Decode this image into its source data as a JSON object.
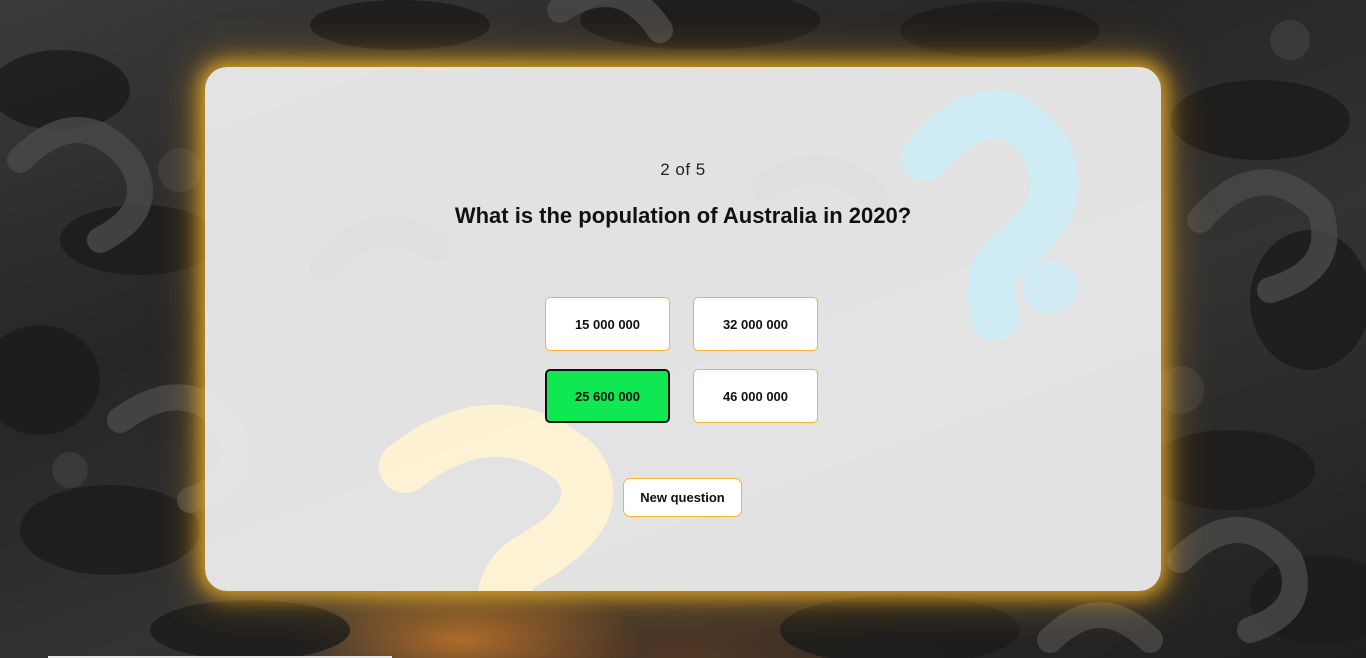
{
  "quiz": {
    "progress_text": "2 of 5",
    "question": "What is the population of Australia in 2020?",
    "answers": [
      {
        "label": "15 000 000",
        "state": "default"
      },
      {
        "label": "32 000 000",
        "state": "default"
      },
      {
        "label": "25 600 000",
        "state": "correct"
      },
      {
        "label": "46 000 000",
        "state": "default"
      }
    ],
    "new_question_label": "New question"
  },
  "colors": {
    "accent_border": "#f2b632",
    "correct_fill": "#0fe853",
    "card_background": "#eeeeee",
    "glow": "#f5b428"
  },
  "background": {
    "theme": "3d-question-marks-dark"
  }
}
